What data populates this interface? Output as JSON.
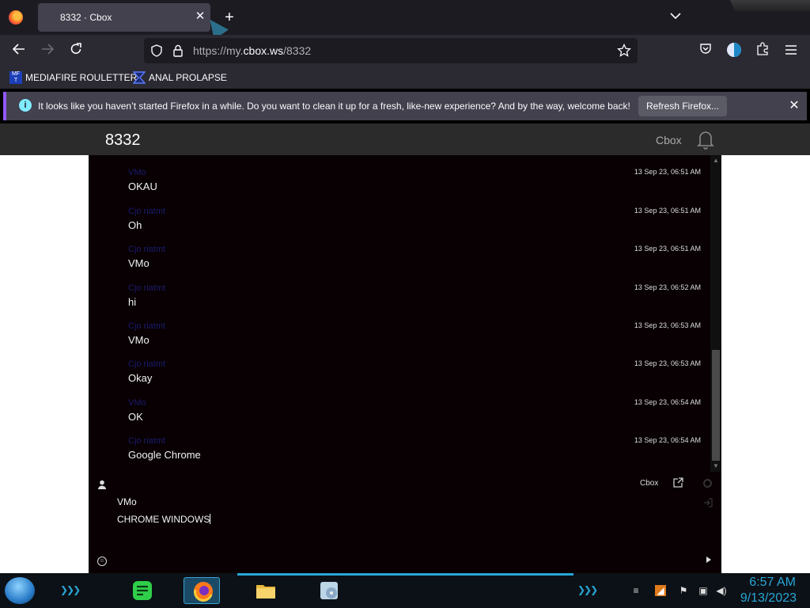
{
  "browser": {
    "tab_title": "8332 · Cbox",
    "url_prefix": "https://my.",
    "url_domain": "cbox.ws",
    "url_path": "/8332",
    "bookmarks": [
      {
        "label": "MEDIAFIRE ROULETTER",
        "icon": "mediafire-icon"
      },
      {
        "label": "ANAL PROLAPSE",
        "icon": "bookmark-icon"
      }
    ],
    "notice_text": "It looks like you haven’t started Firefox in a while. Do you want to clean it up for a fresh, like-new experience? And by the way, welcome back!",
    "notice_button": "Refresh Firefox...",
    "favicon_text": "MF T"
  },
  "cbox": {
    "title": "8332",
    "brand": "Cbox",
    "messages": [
      {
        "name": "VMo",
        "time": "13 Sep 23, 06:51 AM",
        "text": "OKAU"
      },
      {
        "name": "Cjo riatmt",
        "time": "13 Sep 23, 06:51 AM",
        "text": "Oh"
      },
      {
        "name": "Cjo riatmt",
        "time": "13 Sep 23, 06:51 AM",
        "text": "VMo"
      },
      {
        "name": "Cjo riatmt",
        "time": "13 Sep 23, 06:52 AM",
        "text": "hi"
      },
      {
        "name": "Cjo riatmt",
        "time": "13 Sep 23, 06:53 AM",
        "text": "VMo"
      },
      {
        "name": "Cjo riatmt",
        "time": "13 Sep 23, 06:53 AM",
        "text": "Okay"
      },
      {
        "name": "VMo",
        "time": "13 Sep 23, 06:54 AM",
        "text": "OK"
      },
      {
        "name": "Cjo riatmt",
        "time": "13 Sep 23, 06:54 AM",
        "text": "Google Chrome"
      }
    ],
    "compose": {
      "brand": "Cbox",
      "username": "VMo",
      "message": "CHROME WINDOWS"
    }
  },
  "taskbar": {
    "time": "6:57 AM",
    "date": "9/13/2023",
    "apps": [
      "notes-app-icon",
      "firefox-icon",
      "file-explorer-icon",
      "media-icon"
    ]
  },
  "colors": {
    "accent": "#28a6d6",
    "chat_bg": "#080002",
    "username": "#1b1b6e",
    "firefox_notice_accent": "#9059ff"
  }
}
